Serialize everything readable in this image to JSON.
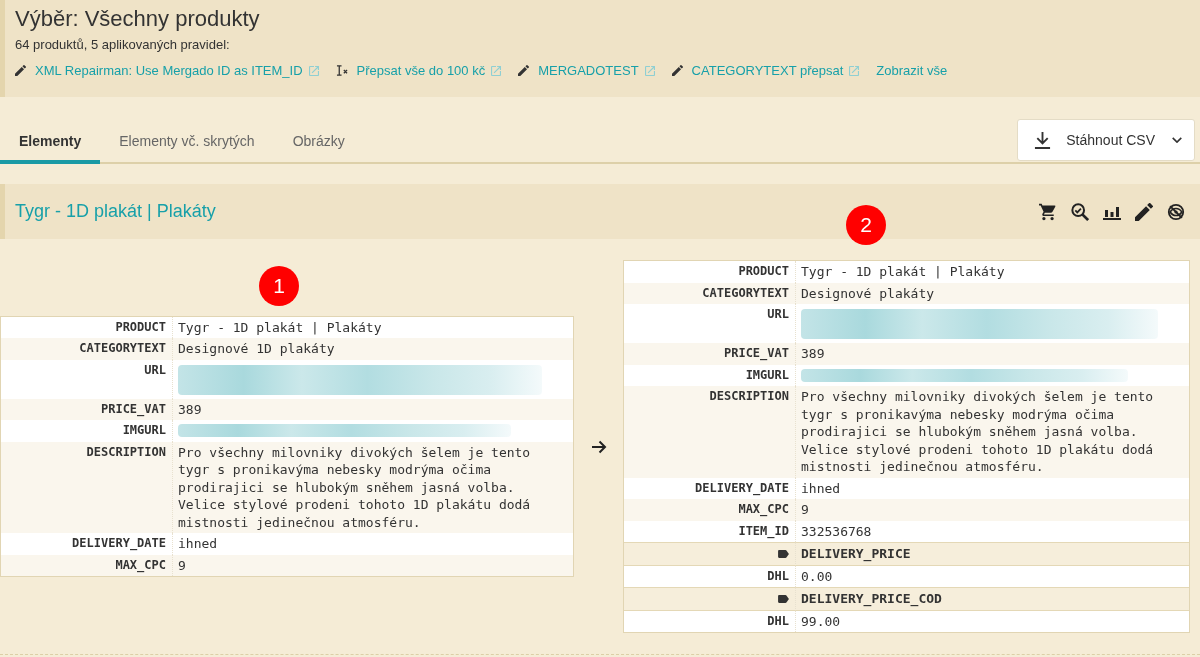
{
  "header": {
    "title": "Výběr: Všechny produkty",
    "summary": "64 produktů, 5 aplikovaných pravidel:",
    "rules": [
      {
        "kind": "edit",
        "label": "XML Repairman: Use Mergado ID as ITEM_ID",
        "external": true
      },
      {
        "kind": "clear",
        "label": "Přepsat vše do 100 kč",
        "external": true
      },
      {
        "kind": "edit",
        "label": "MERGADOTEST",
        "external": true
      },
      {
        "kind": "edit",
        "label": "CATEGORYTEXT přepsat",
        "external": true
      }
    ],
    "show_all": "Zobrazit vše"
  },
  "tabs": [
    {
      "label": "Elementy",
      "selected": true
    },
    {
      "label": "Elementy vč. skrytých",
      "selected": false
    },
    {
      "label": "Obrázky",
      "selected": false
    }
  ],
  "download_button": {
    "label": "Stáhnout CSV"
  },
  "product": {
    "title": "Tygr - 1D plakát | Plakáty"
  },
  "comparison": {
    "before": {
      "marker": "1",
      "rows": [
        {
          "kind": "text",
          "label": "PRODUCT",
          "value": "Tygr - 1D plakát | Plakáty"
        },
        {
          "kind": "text",
          "label": "CATEGORYTEXT",
          "value": "Designové 1D plakáty"
        },
        {
          "kind": "redacted_long",
          "label": "URL"
        },
        {
          "kind": "text",
          "label": "PRICE_VAT",
          "value": "389"
        },
        {
          "kind": "redacted",
          "label": "IMGURL"
        },
        {
          "kind": "text",
          "label": "DESCRIPTION",
          "value": "Pro všechny milovniky divokých šelem je tento tygr s pronikavýma nebesky modrýma očima prodirajici se hlubokým sněhem jasná volba. Velice stylové prodeni tohoto 1D plakátu dodá mistnosti jedinečnou atmosféru."
        },
        {
          "kind": "text",
          "label": "DELIVERY_DATE",
          "value": "ihned"
        },
        {
          "kind": "text",
          "label": "MAX_CPC",
          "value": "9"
        }
      ]
    },
    "after": {
      "marker": "2",
      "rows": [
        {
          "kind": "text",
          "label": "PRODUCT",
          "value": "Tygr - 1D plakát | Plakáty"
        },
        {
          "kind": "text",
          "label": "CATEGORYTEXT",
          "value": "Designové plakáty"
        },
        {
          "kind": "redacted_long",
          "label": "URL"
        },
        {
          "kind": "text",
          "label": "PRICE_VAT",
          "value": "389"
        },
        {
          "kind": "redacted",
          "label": "IMGURL"
        },
        {
          "kind": "text",
          "label": "DESCRIPTION",
          "value": "Pro všechny milovniky divokých šelem je tento tygr s pronikavýma nebesky modrýma očima prodirajici se hlubokým sněhem jasná volba. Velice stylové prodeni tohoto 1D plakátu dodá mistnosti jedinečnou atmosféru."
        },
        {
          "kind": "text",
          "label": "DELIVERY_DATE",
          "value": "ihned"
        },
        {
          "kind": "text",
          "label": "MAX_CPC",
          "value": "9"
        },
        {
          "kind": "text",
          "label": "ITEM_ID",
          "value": "332536768"
        },
        {
          "kind": "group",
          "value": "DELIVERY_PRICE"
        },
        {
          "kind": "text",
          "label": "DHL",
          "value": "0.00"
        },
        {
          "kind": "group",
          "value": "DELIVERY_PRICE_COD"
        },
        {
          "kind": "text",
          "label": "DHL",
          "value": "99.00"
        }
      ]
    }
  }
}
